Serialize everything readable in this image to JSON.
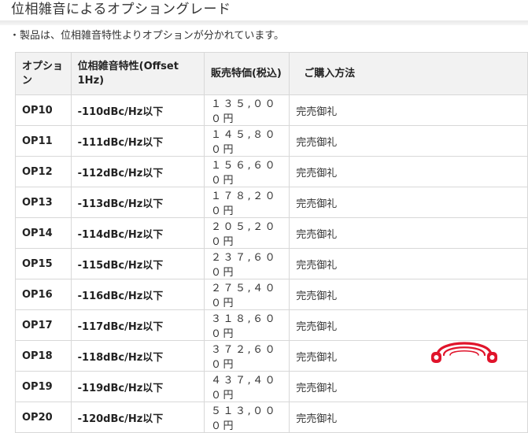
{
  "title": "位相雑音によるオプショングレード",
  "note": "・製品は、位相雑音特性よりオプションが分かれています。",
  "table": {
    "headers": [
      "オプション",
      "位相雑音特性(Offset 1Hz)",
      "販売特価(税込)",
      "ご購入方法"
    ],
    "rows": [
      [
        "OP10",
        "-110dBc/Hz以下",
        "１３５,０００円",
        "完売御礼"
      ],
      [
        "OP11",
        "-111dBc/Hz以下",
        "１４５,８００円",
        "完売御礼"
      ],
      [
        "OP12",
        "-112dBc/Hz以下",
        "１５６,６００円",
        "完売御礼"
      ],
      [
        "OP13",
        "-113dBc/Hz以下",
        "１７８,２００円",
        "完売御礼"
      ],
      [
        "OP14",
        "-114dBc/Hz以下",
        "２０５,２００円",
        "完売御礼"
      ],
      [
        "OP15",
        "-115dBc/Hz以下",
        "２３７,６００円",
        "完売御礼"
      ],
      [
        "OP16",
        "-116dBc/Hz以下",
        "２７５,４００円",
        "完売御礼"
      ],
      [
        "OP17",
        "-117dBc/Hz以下",
        "３１８,６００円",
        "完売御礼"
      ],
      [
        "OP18",
        "-118dBc/Hz以下",
        "３７２,６００円",
        "完売御礼"
      ],
      [
        "OP19",
        "-119dBc/Hz以下",
        "４３７,４００円",
        "完売御礼"
      ],
      [
        "OP20",
        "-120dBc/Hz以下",
        "５１３,０００円",
        "完売御礼"
      ]
    ]
  },
  "logo": {
    "icon": "headphones-logo-icon",
    "color": "#e0142b"
  }
}
